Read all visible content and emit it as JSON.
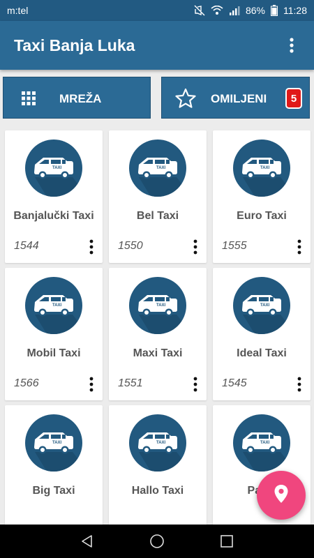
{
  "status_bar": {
    "carrier": "m:tel",
    "battery": "86%",
    "time": "11:28",
    "icons": [
      "mute-icon",
      "wifi-icon",
      "signal-icon",
      "battery-icon"
    ]
  },
  "app_bar": {
    "title": "Taxi Banja Luka",
    "menu_icon": "more-vert-icon"
  },
  "tabs": [
    {
      "label": "MREŽA",
      "icon": "grid-icon"
    },
    {
      "label": "OMILJENI",
      "icon": "star-outline-icon",
      "badge": "5"
    }
  ],
  "taxis": [
    {
      "name": "Banjalučki Taxi",
      "number": "1544"
    },
    {
      "name": "Bel Taxi",
      "number": "1550"
    },
    {
      "name": "Euro Taxi",
      "number": "1555"
    },
    {
      "name": "Mobil Taxi",
      "number": "1566"
    },
    {
      "name": "Maxi Taxi",
      "number": "1551"
    },
    {
      "name": "Ideal Taxi",
      "number": "1545"
    },
    {
      "name": "Big Taxi",
      "number": ""
    },
    {
      "name": "Hallo Taxi",
      "number": ""
    },
    {
      "name": "Patro",
      "number": ""
    }
  ],
  "taxi_icon_label": "TAXI",
  "fab": {
    "icon": "location-pin-icon"
  },
  "nav_bar": {
    "icons": [
      "back-icon",
      "home-icon",
      "recents-icon"
    ]
  },
  "colors": {
    "primary": "#2b6a95",
    "status_bar": "#225a82",
    "icon_circle": "#22597f",
    "fab": "#f0467e",
    "badge": "#e01919",
    "card_text": "#555555"
  }
}
